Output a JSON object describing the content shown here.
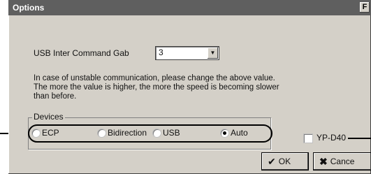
{
  "window": {
    "title": "Options",
    "title_button": "F"
  },
  "usb_gap": {
    "label": "USB Inter Command Gab",
    "value": "3"
  },
  "info_lines": [
    "In case of unstable communication, please change the above value.",
    "The more the value is higher, the more the speed is becoming slower",
    "than before."
  ],
  "devices": {
    "label": "Devices",
    "options": [
      {
        "label": "ECP",
        "checked": false
      },
      {
        "label": "Bidirection",
        "checked": false
      },
      {
        "label": "USB",
        "checked": false
      },
      {
        "label": "Auto",
        "checked": true
      }
    ]
  },
  "yp_checkbox": {
    "label": "YP-D40",
    "checked": false
  },
  "buttons": {
    "ok": "OK",
    "cancel": "Cance"
  },
  "icons": {
    "ok": "check-icon",
    "cancel": "x-icon"
  }
}
